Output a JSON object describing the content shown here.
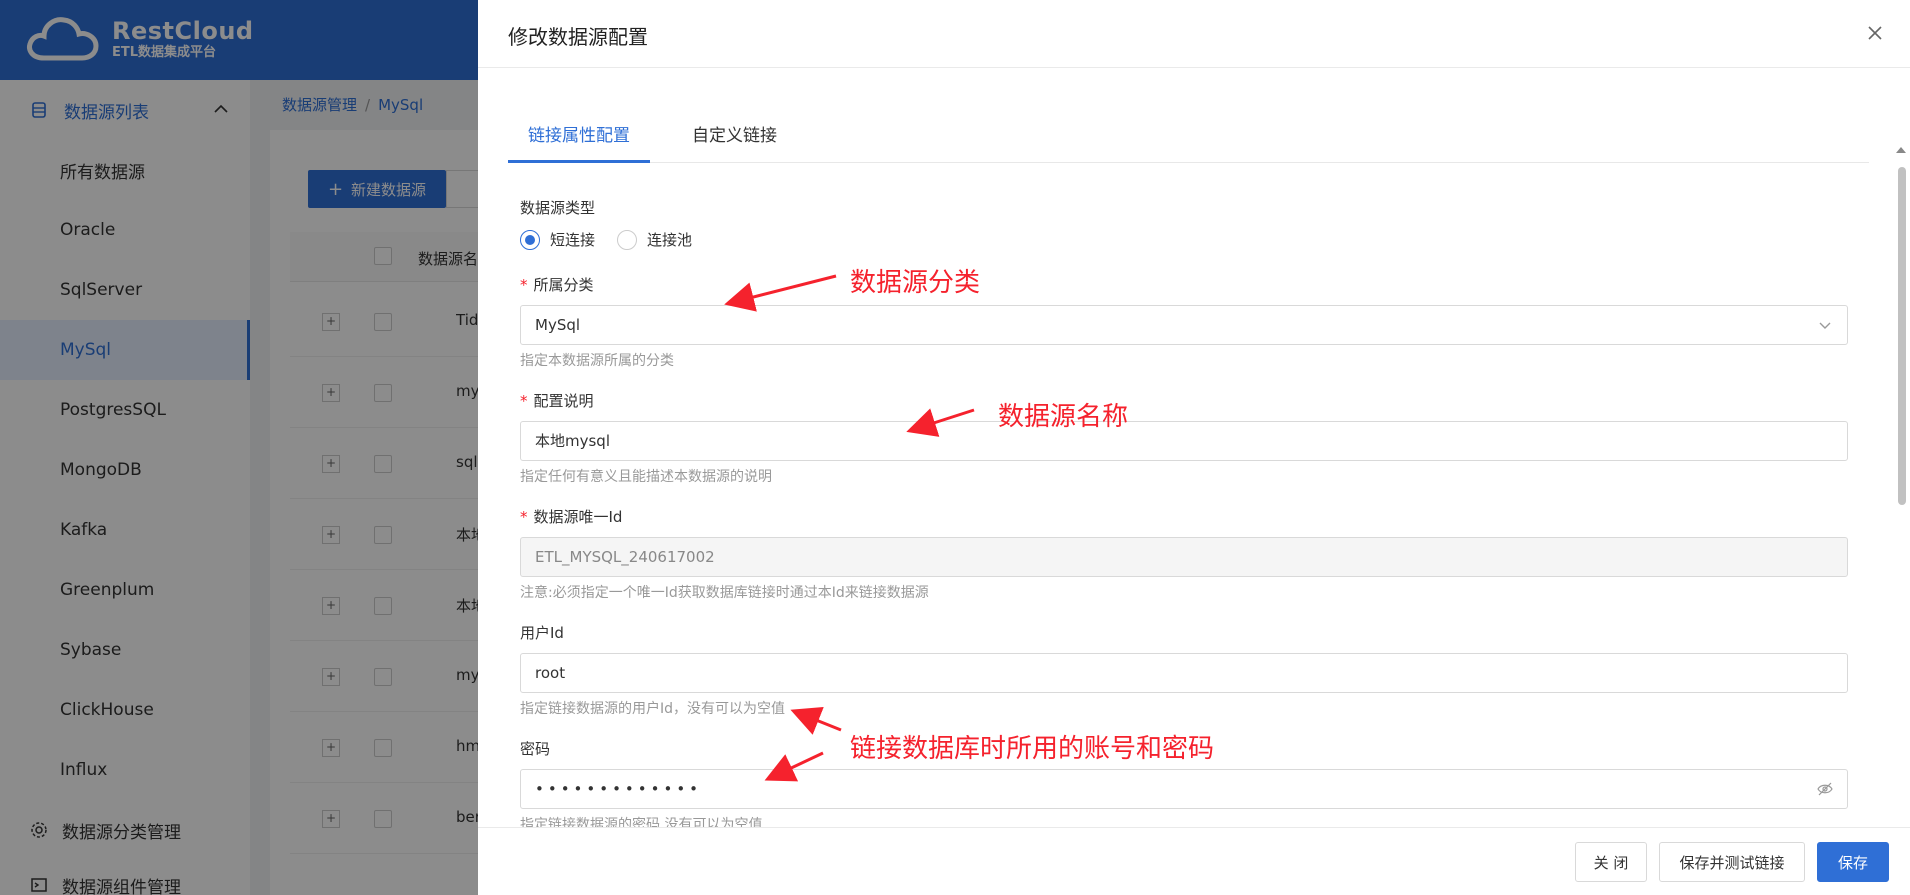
{
  "brand": {
    "title": "RestCloud",
    "subtitle": "ETL数据集成平台"
  },
  "sidebar": {
    "group_label": "数据源列表",
    "items": [
      "所有数据源",
      "Oracle",
      "SqlServer",
      "MySql",
      "PostgresSQL",
      "MongoDB",
      "Kafka",
      "Greenplum",
      "Sybase",
      "ClickHouse",
      "Influx"
    ],
    "active": "MySql",
    "bottom_items": [
      "数据源分类管理",
      "数据源组件管理"
    ]
  },
  "breadcrumb": [
    "数据源管理",
    "MySql"
  ],
  "toolbar": {
    "new_label": "新建数据源"
  },
  "table": {
    "header_name": "数据源名",
    "rows": [
      "Tid",
      "my",
      "sqli",
      "本地",
      "本地",
      "my",
      "hm",
      "ber"
    ]
  },
  "drawer": {
    "title": "修改数据源配置",
    "tabs": [
      "链接属性配置",
      "自定义链接"
    ],
    "active_tab": "链接属性配置",
    "source_type": {
      "label": "数据源类型",
      "options": [
        "短连接",
        "连接池"
      ],
      "selected": "短连接"
    },
    "category": {
      "label": "所属分类",
      "value": "MySql",
      "help": "指定本数据源所属的分类"
    },
    "description": {
      "label": "配置说明",
      "value": "本地mysql",
      "help": "指定任何有意义且能描述本数据源的说明"
    },
    "unique_id": {
      "label": "数据源唯一Id",
      "value": "ETL_MYSQL_240617002",
      "help": "注意:必须指定一个唯一Id获取数据库链接时通过本Id来链接数据源"
    },
    "user_id": {
      "label": "用户Id",
      "value": "root",
      "help": "指定链接数据源的用户Id，没有可以为空值"
    },
    "password": {
      "label": "密码",
      "value": "•••••••••••••",
      "help": "指定链接数据源的密码,没有可以为空值"
    },
    "buttons": {
      "close": "关 闭",
      "save_test": "保存并测试链接",
      "save": "保存"
    }
  },
  "annotations": {
    "category": "数据源分类",
    "name": "数据源名称",
    "account": "链接数据库时所用的账号和密码"
  },
  "colors": {
    "primary": "#2f6fd6",
    "annotation": "#f5222d"
  }
}
